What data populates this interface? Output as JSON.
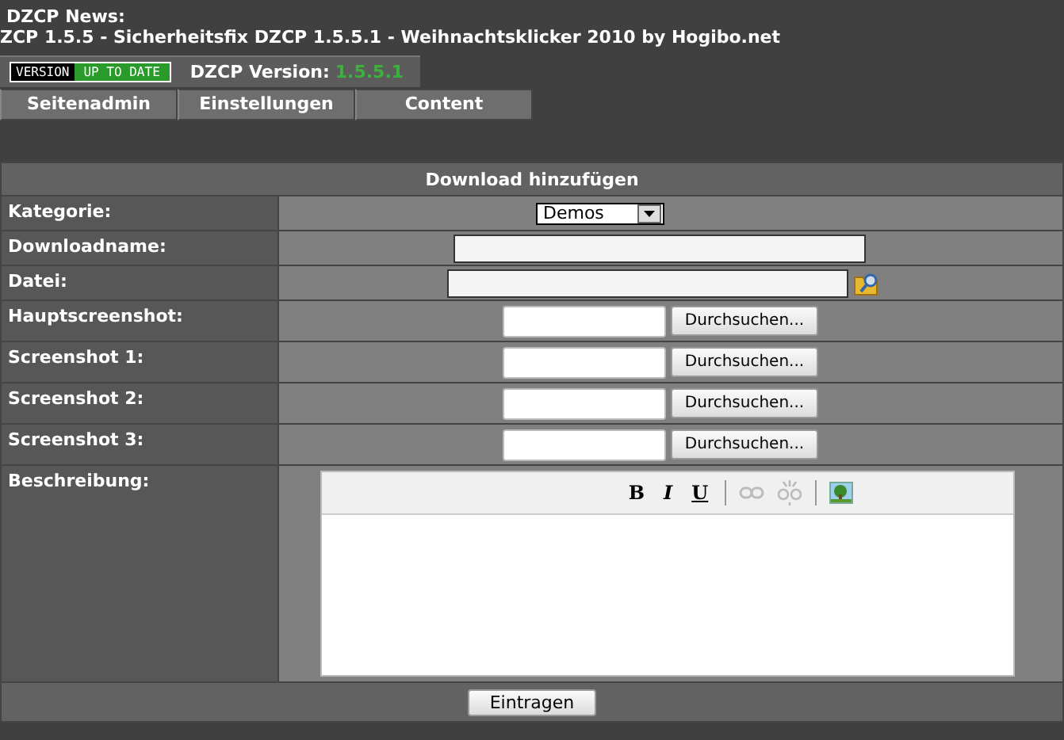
{
  "header": {
    "title": "DZCP News:",
    "subtitle": "ZCP 1.5.5 - Sicherheitsfix DZCP 1.5.5.1 - Weihnachtsklicker 2010 by Hogibo.net"
  },
  "version_bar": {
    "badge_left": "VERSION",
    "badge_right": "UP TO DATE",
    "label": "DZCP Version:",
    "value": "1.5.5.1"
  },
  "tabs": [
    {
      "label": "Seitenadmin"
    },
    {
      "label": "Einstellungen"
    },
    {
      "label": "Content"
    }
  ],
  "form": {
    "title": "Download hinzufügen",
    "rows": [
      {
        "label": "Kategorie:",
        "kind": "select",
        "value": "Demos"
      },
      {
        "label": "Downloadname:",
        "kind": "text"
      },
      {
        "label": "Datei:",
        "kind": "file_pick"
      },
      {
        "label": "Hauptscreenshot:",
        "kind": "upload",
        "button": "Durchsuchen..."
      },
      {
        "label": "Screenshot 1:",
        "kind": "upload",
        "button": "Durchsuchen..."
      },
      {
        "label": "Screenshot 2:",
        "kind": "upload",
        "button": "Durchsuchen..."
      },
      {
        "label": "Screenshot 3:",
        "kind": "upload",
        "button": "Durchsuchen..."
      },
      {
        "label": "Beschreibung:",
        "kind": "editor"
      }
    ],
    "editor_toolbar": [
      {
        "kind": "bold",
        "label": "B",
        "disabled": false
      },
      {
        "kind": "italic",
        "label": "I",
        "disabled": false
      },
      {
        "kind": "underline",
        "label": "U",
        "disabled": false
      },
      {
        "kind": "separator"
      },
      {
        "kind": "link",
        "disabled": true
      },
      {
        "kind": "unlink",
        "disabled": true
      },
      {
        "kind": "separator"
      },
      {
        "kind": "image",
        "disabled": false
      }
    ],
    "submit": "Eintragen"
  }
}
